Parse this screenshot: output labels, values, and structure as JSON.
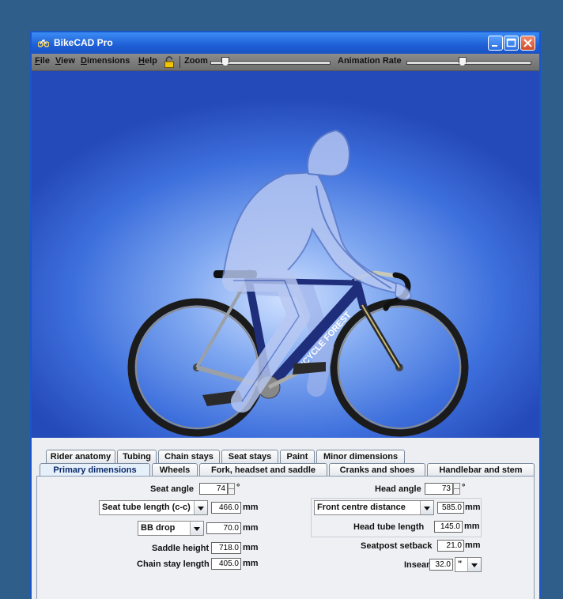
{
  "window": {
    "title": "BikeCAD Pro"
  },
  "menubar": {
    "file": {
      "underline": "F",
      "rest": "ile"
    },
    "view": {
      "underline": "V",
      "rest": "iew"
    },
    "dimensions": {
      "underline": "D",
      "rest": "imensions"
    },
    "help": {
      "underline": "H",
      "rest": "elp"
    },
    "zoom_label": "Zoom",
    "animation_label": "Animation Rate",
    "zoom_level": 0.1,
    "animation_rate": 0.45
  },
  "canvas": {
    "frame_brand": "BICYCLE FOREST",
    "colors": {
      "background": "#3d6fdc",
      "frame": "#1f2e7a",
      "rider": "#b8c8f2",
      "tire": "#1b1b1b"
    }
  },
  "tabs": {
    "row1": [
      "Rider anatomy",
      "Tubing",
      "Chain stays",
      "Seat stays",
      "Paint",
      "Minor dimensions"
    ],
    "row2": [
      "Primary dimensions",
      "Wheels",
      "Fork, headset and saddle",
      "Cranks and shoes",
      "Handlebar and stem"
    ],
    "active": "Primary dimensions"
  },
  "primary": {
    "seat_angle": {
      "label": "Seat angle",
      "value": "74",
      "unit": "°"
    },
    "seat_tube": {
      "selected": "Seat tube length (c-c)",
      "value": "466.0",
      "unit": "mm"
    },
    "bb": {
      "selected": "BB drop",
      "value": "70.0",
      "unit": "mm"
    },
    "saddle_height": {
      "label": "Saddle height",
      "value": "718.0",
      "unit": "mm"
    },
    "chain_stay": {
      "label": "Chain stay length",
      "value": "405.0",
      "unit": "mm"
    },
    "head_angle": {
      "label": "Head angle",
      "value": "73",
      "unit": "°"
    },
    "front_centre": {
      "selected": "Front centre distance",
      "value": "585.0",
      "unit": "mm"
    },
    "head_tube": {
      "label": "Head tube length",
      "value": "145.0",
      "unit": "mm"
    },
    "seatpost": {
      "label": "Seatpost setback",
      "value": "21.0",
      "unit": "mm"
    },
    "inseam": {
      "label": "Inseam",
      "value": "32.0",
      "unit": "\""
    }
  }
}
